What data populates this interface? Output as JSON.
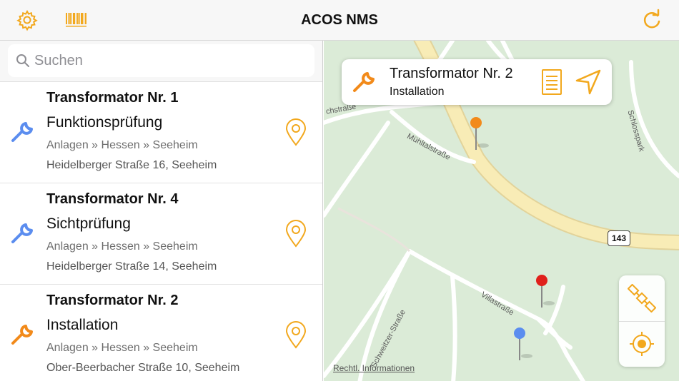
{
  "header": {
    "title": "ACOS NMS",
    "settings_icon": "gear-icon",
    "barcode_icon": "barcode-icon",
    "refresh_icon": "refresh-icon"
  },
  "search": {
    "placeholder": "Suchen",
    "value": ""
  },
  "items": [
    {
      "title": "Transformator Nr. 1",
      "task": "Funktionsprüfung",
      "path": "Anlagen » Hessen » Seeheim",
      "address": "Heidelberger Straße 16, Seeheim",
      "icon_color": "#5b8def"
    },
    {
      "title": "Transformator Nr. 4",
      "task": "Sichtprüfung",
      "path": "Anlagen » Hessen » Seeheim",
      "address": "Heidelberger Straße 14, Seeheim",
      "icon_color": "#5b8def"
    },
    {
      "title": "Transformator Nr. 2",
      "task": "Installation",
      "path": "Anlagen » Hessen » Seeheim",
      "address": "Ober-Beerbacher Straße 10, Seeheim",
      "icon_color": "#f28a1a"
    }
  ],
  "callout": {
    "title": "Transformator Nr. 2",
    "subtitle": "Installation"
  },
  "map": {
    "legal": "Rechtl. Informationen",
    "route_number": "143",
    "streets": [
      "Mühltalstraße",
      "Schlosspark",
      "Villastraße",
      "Schweitzer-Straße",
      "chstraße"
    ]
  },
  "colors": {
    "accent": "#f2a81d",
    "blue": "#5b8def",
    "orange": "#f28a1a",
    "red": "#e0201b"
  }
}
